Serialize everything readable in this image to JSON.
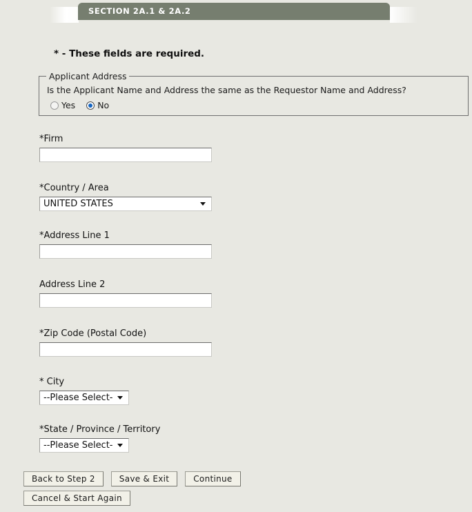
{
  "header": {
    "section_tab_label": "SECTION 2A.1 & 2A.2",
    "tab_color": "#767e6f"
  },
  "page": {
    "background_color": "#e8e8e2",
    "required_note": "* - These fields are required."
  },
  "applicant_address_fieldset": {
    "legend": "Applicant Address",
    "question": "Is the Applicant Name and Address the same as the Requestor Name and Address?",
    "options": [
      {
        "label": "Yes",
        "selected": false
      },
      {
        "label": "No",
        "selected": true
      }
    ],
    "selected_value": "No",
    "selected_radio_color": "#1565c0"
  },
  "fields": {
    "firm": {
      "label": "*Firm",
      "value": "",
      "placeholder": ""
    },
    "country_area": {
      "label": "*Country / Area",
      "selected": "UNITED STATES"
    },
    "address_line_1": {
      "label": "*Address Line 1",
      "value": "",
      "placeholder": ""
    },
    "address_line_2": {
      "label": "Address Line 2",
      "value": "",
      "placeholder": ""
    },
    "zip_code": {
      "label": "*Zip Code (Postal Code)",
      "value": "",
      "placeholder": ""
    },
    "city": {
      "label": "* City",
      "selected": "--Please Select--"
    },
    "state_province_territory": {
      "label": "*State / Province / Territory",
      "selected": "--Please Select--"
    }
  },
  "buttons": {
    "back_to_step_2": "Back to Step 2",
    "save_and_exit": "Save & Exit",
    "continue": "Continue",
    "cancel_and_start_again": "Cancel & Start Again"
  }
}
